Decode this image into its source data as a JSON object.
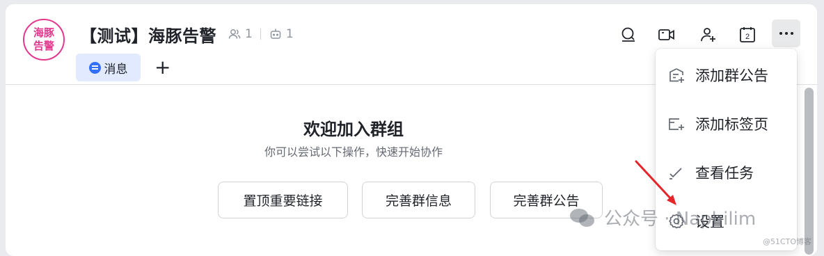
{
  "avatar": {
    "line1": "海豚",
    "line2": "告警",
    "color": "#e4388e"
  },
  "header": {
    "title": "【测试】海豚告警",
    "member_count": "1",
    "bot_count": "1"
  },
  "tabs": [
    {
      "label": "消息",
      "active": true
    }
  ],
  "tab_add_label": "+",
  "header_actions": {
    "search_icon": "search-icon",
    "video_icon": "video-icon",
    "add_member_icon": "add-member-icon",
    "calendar_icon": "calendar-icon",
    "calendar_day": "2",
    "more_icon": "more-icon"
  },
  "welcome": {
    "title": "欢迎加入群组",
    "subtitle": "你可以尝试以下操作，快速开始协作"
  },
  "actions": [
    {
      "label": "置顶重要链接"
    },
    {
      "label": "完善群信息"
    },
    {
      "label": "完善群公告"
    }
  ],
  "menu": {
    "items": [
      {
        "label": "添加群公告",
        "icon": "add-announcement-icon"
      },
      {
        "label": "添加标签页",
        "icon": "add-tab-icon"
      },
      {
        "label": "查看任务",
        "icon": "task-check-icon"
      },
      {
        "label": "设置",
        "icon": "settings-gear-icon"
      }
    ]
  },
  "watermark": {
    "text": "公众号 · Naphilim",
    "corner": "@51CTO博客"
  },
  "colors": {
    "accent": "#3370ff",
    "tab_bg": "#e1eaff",
    "arrow": "#e5252a"
  }
}
